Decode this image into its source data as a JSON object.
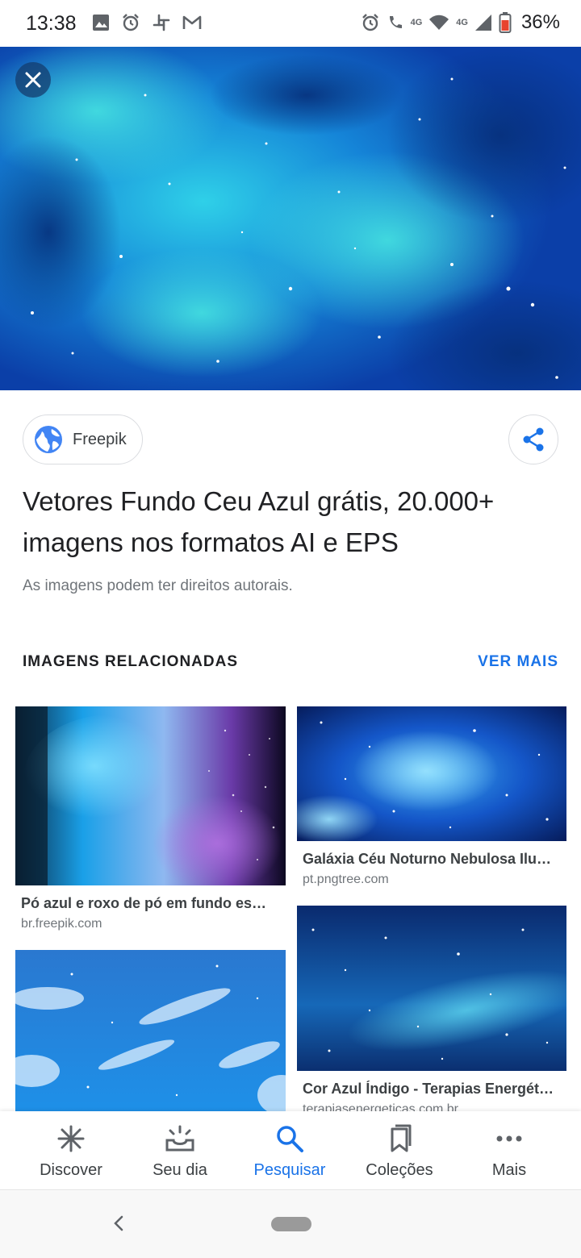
{
  "status_bar": {
    "time": "13:38",
    "network_small_1": "4G",
    "network_small_2": "4G",
    "battery": "36%"
  },
  "hero": {
    "close_label": "Fechar"
  },
  "source": {
    "name": "Freepik"
  },
  "result": {
    "title": "Vetores Fundo Ceu Azul grátis, 20.000+ imagens nos formatos AI e EPS",
    "copyright": "As imagens podem ter direitos autorais."
  },
  "related": {
    "heading": "IMAGENS RELACIONADAS",
    "see_more": "VER MAIS",
    "items": [
      {
        "title": "Pó azul e roxo de pó em fundo es…",
        "source": "br.freepik.com"
      },
      {
        "title": "Galáxia Céu Noturno Nebulosa Ilu…",
        "source": "pt.pngtree.com"
      },
      {
        "title": "",
        "source": ""
      },
      {
        "title": "Cor Azul Índigo - Terapias Energét…",
        "source": "terapiasenergeticas.com.br"
      }
    ]
  },
  "bottom_nav": {
    "items": [
      {
        "label": "Discover",
        "icon": "asterisk-icon"
      },
      {
        "label": "Seu dia",
        "icon": "sunrise-icon"
      },
      {
        "label": "Pesquisar",
        "icon": "search-icon",
        "active": true
      },
      {
        "label": "Coleções",
        "icon": "bookmarks-icon"
      },
      {
        "label": "Mais",
        "icon": "more-dots-icon"
      }
    ]
  },
  "colors": {
    "accent": "#1a73e8",
    "text_primary": "#202124",
    "text_secondary": "#70757a"
  }
}
